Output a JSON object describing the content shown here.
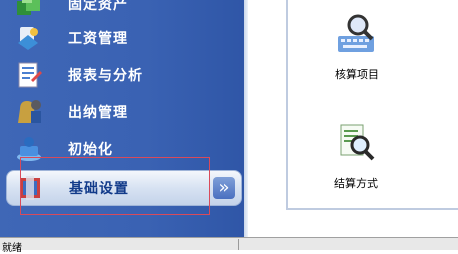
{
  "nav": {
    "items": [
      {
        "label": "固定资产",
        "icon": "cube-stack-icon"
      },
      {
        "label": "工资管理",
        "icon": "payroll-icon"
      },
      {
        "label": "报表与分析",
        "icon": "report-icon"
      },
      {
        "label": "出纳管理",
        "icon": "cashier-icon"
      },
      {
        "label": "初始化",
        "icon": "init-icon"
      },
      {
        "label": "基础设置",
        "icon": "basic-settings-icon",
        "selected": true
      }
    ],
    "expand_glyph": "»"
  },
  "content": {
    "tiles": [
      {
        "label": "核算项目",
        "icon": "keyboard-magnifier-icon"
      },
      {
        "label": "结算方式",
        "icon": "document-magnifier-icon"
      }
    ]
  },
  "status_bar": {
    "text": "就绪"
  },
  "colors": {
    "nav_bg": "#3a62b3",
    "selected_bg": "#d7e2f2",
    "highlight_border": "#d94a5a"
  }
}
